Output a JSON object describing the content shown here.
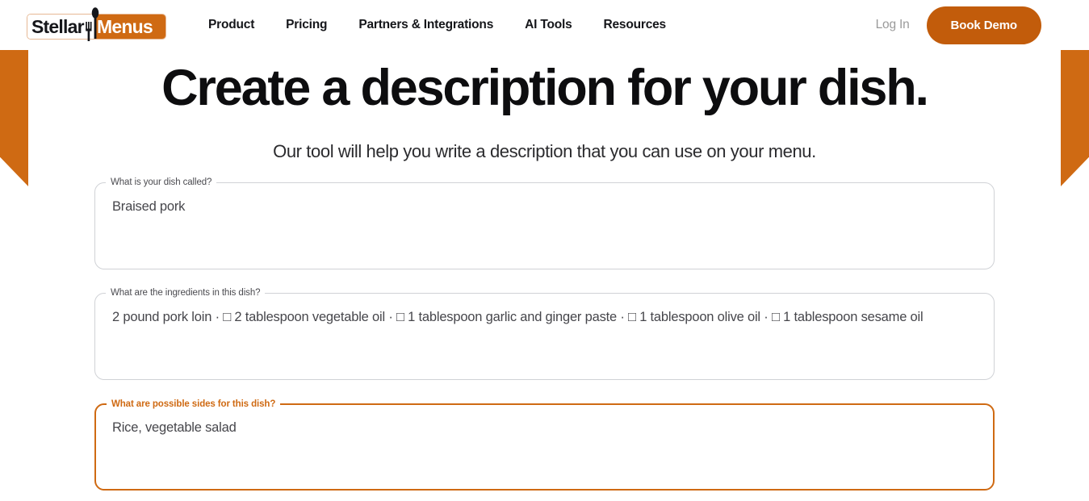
{
  "header": {
    "logo": {
      "text_left": "Stellar",
      "text_right": "Menus",
      "icon": "spoon-fork-icon"
    },
    "nav_items": [
      {
        "label": "Product"
      },
      {
        "label": "Pricing"
      },
      {
        "label": "Partners & Integrations"
      },
      {
        "label": "AI Tools"
      },
      {
        "label": "Resources"
      }
    ],
    "login_label": "Log In",
    "book_demo_label": "Book Demo"
  },
  "main": {
    "title": "Create a description for your dish.",
    "subtitle": "Our tool will help you write a description that you can use on your menu.",
    "fields": [
      {
        "label": "What is your dish called?",
        "value": "Braised pork",
        "focused": false
      },
      {
        "label": "What are the ingredients in this dish?",
        "value": "2 pound pork loin · □ 2 tablespoon vegetable oil · □ 1 tablespoon garlic and ginger paste · □ 1 tablespoon olive oil · □ 1 tablespoon sesame oil",
        "focused": false
      },
      {
        "label": "What are possible sides for this dish?",
        "value": "Rice, vegetable salad",
        "focused": true
      }
    ]
  },
  "colors": {
    "brand_orange": "#cf6a13",
    "button_orange": "#c25c0b",
    "text_dark": "#0d0d0f",
    "text_muted": "#9a9a9a",
    "border_grey": "#d0d2d6"
  }
}
